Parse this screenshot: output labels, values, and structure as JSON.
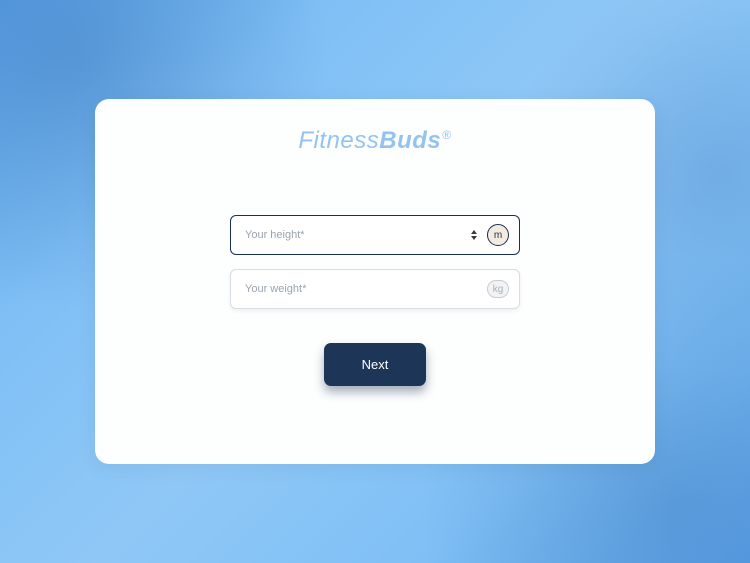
{
  "brand": {
    "first": "Fitness",
    "second": "Buds",
    "reg": "®"
  },
  "form": {
    "height": {
      "placeholder": "Your height*",
      "unit": "m"
    },
    "weight": {
      "placeholder": "Your weight*",
      "unit": "kg"
    }
  },
  "actions": {
    "next": "Next"
  },
  "colors": {
    "accent": "#1d3557",
    "brand": "#94c3f0",
    "bg": "#7fbff5"
  }
}
